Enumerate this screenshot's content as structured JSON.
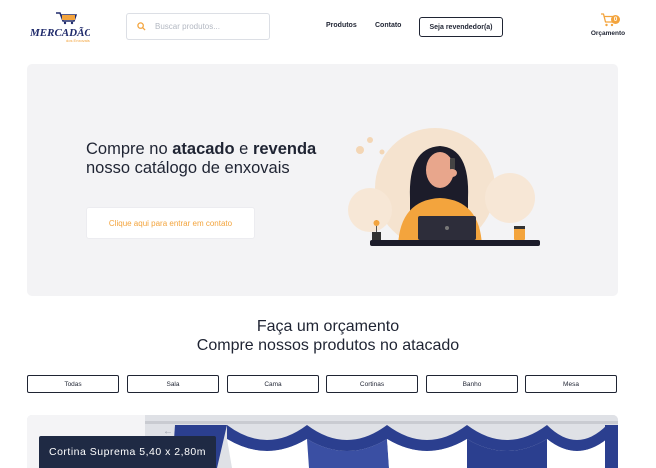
{
  "header": {
    "logo_text": "MERCADÃO",
    "logo_subtext": "dos Enxovais",
    "search_placeholder": "Buscar produtos...",
    "nav": [
      "Produtos",
      "Contato"
    ],
    "reseller_button": "Seja revendedor(a)",
    "cart_count": "0",
    "cart_label": "Orçamento"
  },
  "hero": {
    "title_part1": "Compre no ",
    "title_bold1": "atacado",
    "title_part2": " e ",
    "title_bold2": "revenda",
    "title_line2": "nosso catálogo de enxovais",
    "cta": "Clique aqui para entrar em contato"
  },
  "section": {
    "heading1": "Faça um orçamento",
    "heading2": "Compre nossos produtos no atacado"
  },
  "filters": [
    "Todas",
    "Sala",
    "Cama",
    "Cortinas",
    "Banho",
    "Mesa"
  ],
  "product": {
    "name": "Cortina Suprema 5,40 x 2,80m"
  },
  "colors": {
    "accent": "#f3a43d",
    "navy": "#1f2433",
    "hero_bg": "#f3f3f5",
    "curtain_blue": "#2b3f8f"
  },
  "icons": [
    "search-icon",
    "cart-icon"
  ]
}
